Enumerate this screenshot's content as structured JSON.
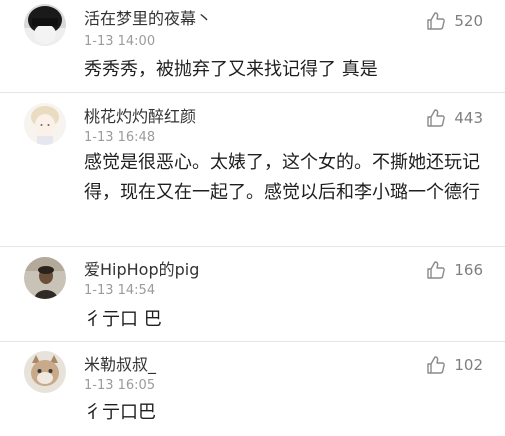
{
  "comments": [
    {
      "username": "活在梦里的夜幕丶",
      "timestamp": "1-13 14:00",
      "likes": "520",
      "text": "秀秀秀，被抛弃了又来找记得了  真是"
    },
    {
      "username": "桃花灼灼醉红颜",
      "timestamp": "1-13 16:48",
      "likes": "443",
      "text": "感觉是很恶心。太婊了，这个女的。不撕她还玩记得，现在又在一起了。感觉以后和李小璐一个德行"
    },
    {
      "username": "爱HipHop的pig",
      "timestamp": "1-13 14:54",
      "likes": "166",
      "text": "彳亍口 巴"
    },
    {
      "username": "米勒叔叔_",
      "timestamp": "1-13 16:05",
      "likes": "102",
      "text": "彳亍口巴"
    }
  ],
  "icons": {
    "like": "thumbs-up-outline-icon"
  },
  "colors": {
    "username": "#333333",
    "timestamp": "#9b9b9b",
    "like_count": "#7f7f7f",
    "text": "#1f1f1f",
    "divider": "#e6e6e6"
  }
}
